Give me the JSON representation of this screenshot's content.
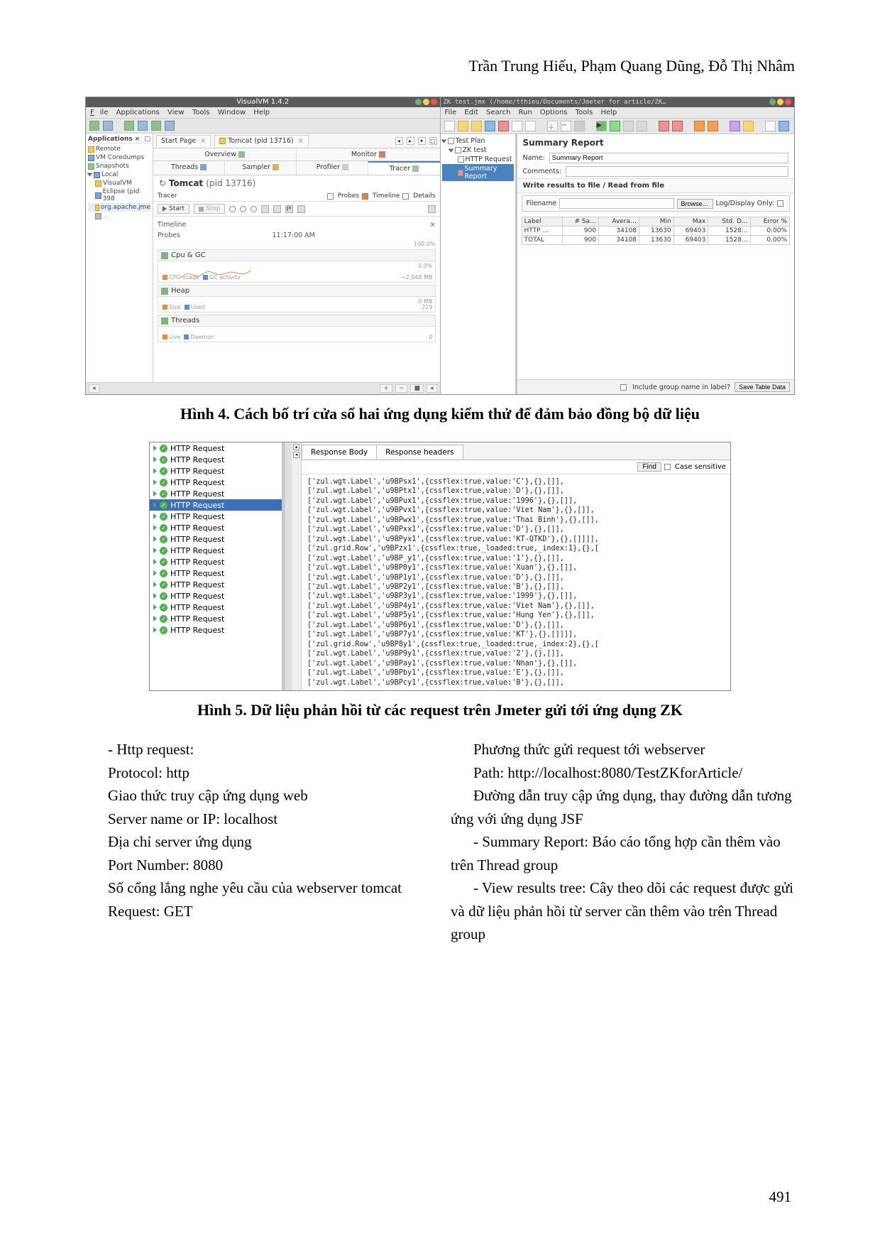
{
  "authors": "Trần Trung Hiếu, Phạm Quang Dũng, Đỗ Thị Nhâm",
  "page_number": "491",
  "fig4": {
    "caption": "Hình 4. Cách bố trí cửa sổ hai ứng dụng kiểm thử để đảm bảo đồng bộ dữ liệu",
    "visualvm": {
      "title": "VisualVM 1.4.2",
      "menu": [
        "File",
        "Applications",
        "View",
        "Tools",
        "Window",
        "Help"
      ],
      "side_header": "Applications",
      "nodes": {
        "remote": "Remote",
        "vm_coredumps": "VM Coredumps",
        "snapshots": "Snapshots",
        "local": "Local",
        "visualvm": "VisualVM",
        "eclipse": "Eclipse (pid 398",
        "apache": "org.apache.jme"
      },
      "tabs1": {
        "start": "Start Page",
        "tomcat": "Tomcat (pid 13716)"
      },
      "sub_tabs": {
        "overview": "Overview",
        "monitor": "Monitor",
        "threads": "Threads",
        "sampler": "Sampler",
        "profiler": "Profiler",
        "tracer": "Tracer"
      },
      "tomcat_head": {
        "pre": "Tomcat ",
        "pid": "(pid 13716)"
      },
      "tracer": {
        "label": "Tracer",
        "probes": "Probes",
        "timeline": "Timeline",
        "details": "Details"
      },
      "tool": {
        "start": "Start",
        "stop": "Stop"
      },
      "timeline": {
        "label": "Timeline",
        "ts": "11:17:00 AM",
        "probes": "Probes",
        "pct": "100.0%"
      },
      "cpu": {
        "name": "Cpu & GC",
        "legend1": "CPU usage",
        "legend2": "GC activity",
        "v1": "0.0%",
        "v2": "~2,048 MB"
      },
      "heap": {
        "name": "Heap",
        "legend1": "Size",
        "legend2": "Used",
        "v": "0 MB",
        "v2": "219"
      },
      "threads": {
        "name": "Threads",
        "legend1": "Live",
        "legend2": "Daemon",
        "v": "0"
      }
    },
    "jmeter": {
      "titlebar": "ZK test.jmx (/home/tthieu/Documents/Jmeter for article/ZK…",
      "menu": [
        "File",
        "Edit",
        "Search",
        "Run",
        "Options",
        "Tools",
        "Help"
      ],
      "tree": {
        "root": "Test Plan",
        "zk": "ZK test",
        "http": "HTTP Request",
        "summary": "Summary Report"
      },
      "sr_title": "Summary Report",
      "name_label": "Name:",
      "name_value": "Summary Report",
      "comments_label": "Comments:",
      "io_label": "Write results to file / Read from file",
      "filename_label": "Filename",
      "browse": "Browse…",
      "logdisplay": "Log/Display Only:",
      "headers": [
        "Label",
        "# Sa…",
        "Avera…",
        "Min",
        "Max",
        "Std. D…",
        "Error %"
      ],
      "rows": [
        [
          "HTTP …",
          "900",
          "34108",
          "13630",
          "69403",
          "1528…",
          "0.00%"
        ],
        [
          "TOTAL",
          "900",
          "34108",
          "13630",
          "69403",
          "1528…",
          "0.00%"
        ]
      ],
      "footer": {
        "chk": "Include group name in label?",
        "save": "Save Table Data"
      }
    }
  },
  "fig5": {
    "caption": "Hình 5. Dữ liệu phản hồi từ các request trên Jmeter gửi tới ứng dụng ZK",
    "request_label": "HTTP Request",
    "request_count": 17,
    "selected_index": 5,
    "tabs": {
      "body": "Response Body",
      "headers": "Response headers"
    },
    "find": "Find",
    "case": "Case sensitive",
    "response_lines": [
      "['zul.wgt.Label','u9BPsx1',{cssflex:true,value:'C'},{},[]],",
      "['zul.wgt.Label','u9BPtx1',{cssflex:true,value:'D'},{},[]],",
      "['zul.wgt.Label','u9BPux1',{cssflex:true,value:'1996'},{},[]],",
      "['zul.wgt.Label','u9BPvx1',{cssflex:true,value:'Viet Nam'},{},[]],",
      "['zul.wgt.Label','u9BPwx1',{cssflex:true,value:'Thai Binh'},{},[]],",
      "['zul.wgt.Label','u9BPxx1',{cssflex:true,value:'D'},{},[]],",
      "['zul.wgt.Label','u9BPyx1',{cssflex:true,value:'KT-QTKD'},{},[]]]],",
      "['zul.grid.Row','u9BPzx1',{cssflex:true,_loaded:true,_index:1},{},[",
      "['zul.wgt.Label','u9BP_y1',{cssflex:true,value:'1'},{},[]],",
      "['zul.wgt.Label','u9BP0y1',{cssflex:true,value:'Xuan'},{},[]],",
      "['zul.wgt.Label','u9BP1y1',{cssflex:true,value:'D'},{},[]],",
      "['zul.wgt.Label','u9BP2y1',{cssflex:true,value:'B'},{},[]],",
      "['zul.wgt.Label','u9BP3y1',{cssflex:true,value:'1999'},{},[]],",
      "['zul.wgt.Label','u9BP4y1',{cssflex:true,value:'Viet Nam'},{},[]],",
      "['zul.wgt.Label','u9BP5y1',{cssflex:true,value:'Hung Yen'},{},[]],",
      "['zul.wgt.Label','u9BP6y1',{cssflex:true,value:'D'},{},[]],",
      "['zul.wgt.Label','u9BP7y1',{cssflex:true,value:'KT'},{},[]]]],",
      "['zul.grid.Row','u9BP8y1',{cssflex:true,_loaded:true,_index:2},{},[",
      "['zul.wgt.Label','u9BP9y1',{cssflex:true,value:'2'},{},[]],",
      "['zul.wgt.Label','u9BPay1',{cssflex:true,value:'Nhan'},{},[]],",
      "['zul.wgt.Label','u9BPby1',{cssflex:true,value:'E'},{},[]],",
      "['zul.wgt.Label','u9BPcy1',{cssflex:true,value:'B'},{},[]],"
    ]
  },
  "text": {
    "left": [
      "- Http request:",
      "Protocol: http",
      "Giao thức truy cập ứng dụng web",
      "Server name or IP: localhost",
      "Địa chỉ server ứng dụng",
      "Port Number: 8080",
      "Số cổng lắng nghe yêu cầu của webserver tomcat",
      "Request: GET"
    ],
    "right": [
      "Phương thức gửi request tới webserver",
      "Path: http://localhost:8080/TestZKforArticle/",
      "Đường dẫn truy cập ứng dụng, thay đường dẫn tương ứng với ứng dụng JSF",
      "- Summary Report: Báo cáo tổng hợp cần thêm vào trên Thread group",
      "- View results tree: Cây theo dõi các request được gửi và dữ liệu phản hồi từ server cần thêm vào trên Thread group"
    ]
  }
}
